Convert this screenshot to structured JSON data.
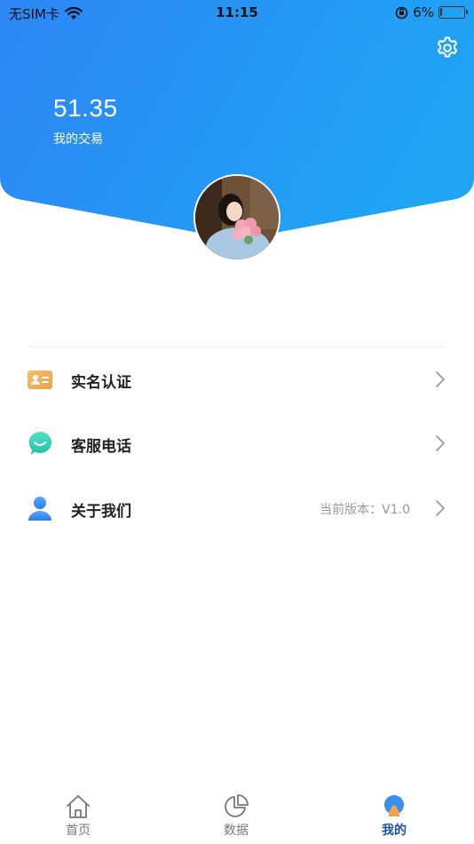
{
  "status_bar": {
    "carrier": "无SIM卡",
    "time": "11:15",
    "battery_percent": "6%",
    "battery_level": 0.06
  },
  "header": {
    "balance": "51.35",
    "balance_label": "我的交易",
    "gradient_start": "#2d86f5",
    "gradient_end": "#1fa4f4"
  },
  "menu": {
    "items": [
      {
        "label": "实名认证",
        "icon": "id-card-icon",
        "extra": ""
      },
      {
        "label": "客服电话",
        "icon": "chat-bubble-icon",
        "extra": ""
      },
      {
        "label": "关于我们",
        "icon": "user-icon",
        "extra": "当前版本：V1.0"
      }
    ]
  },
  "tabbar": {
    "items": [
      {
        "label": "首页",
        "icon": "home-icon",
        "active": false
      },
      {
        "label": "数据",
        "icon": "pie-chart-icon",
        "active": false
      },
      {
        "label": "我的",
        "icon": "profile-icon",
        "active": true
      }
    ]
  },
  "colors": {
    "accent": "#2d86f5",
    "active_tab": "#1e4fa8",
    "id_card": "#f0b45a",
    "chat": "#2fd0b0",
    "user": "#3a8ef0"
  }
}
